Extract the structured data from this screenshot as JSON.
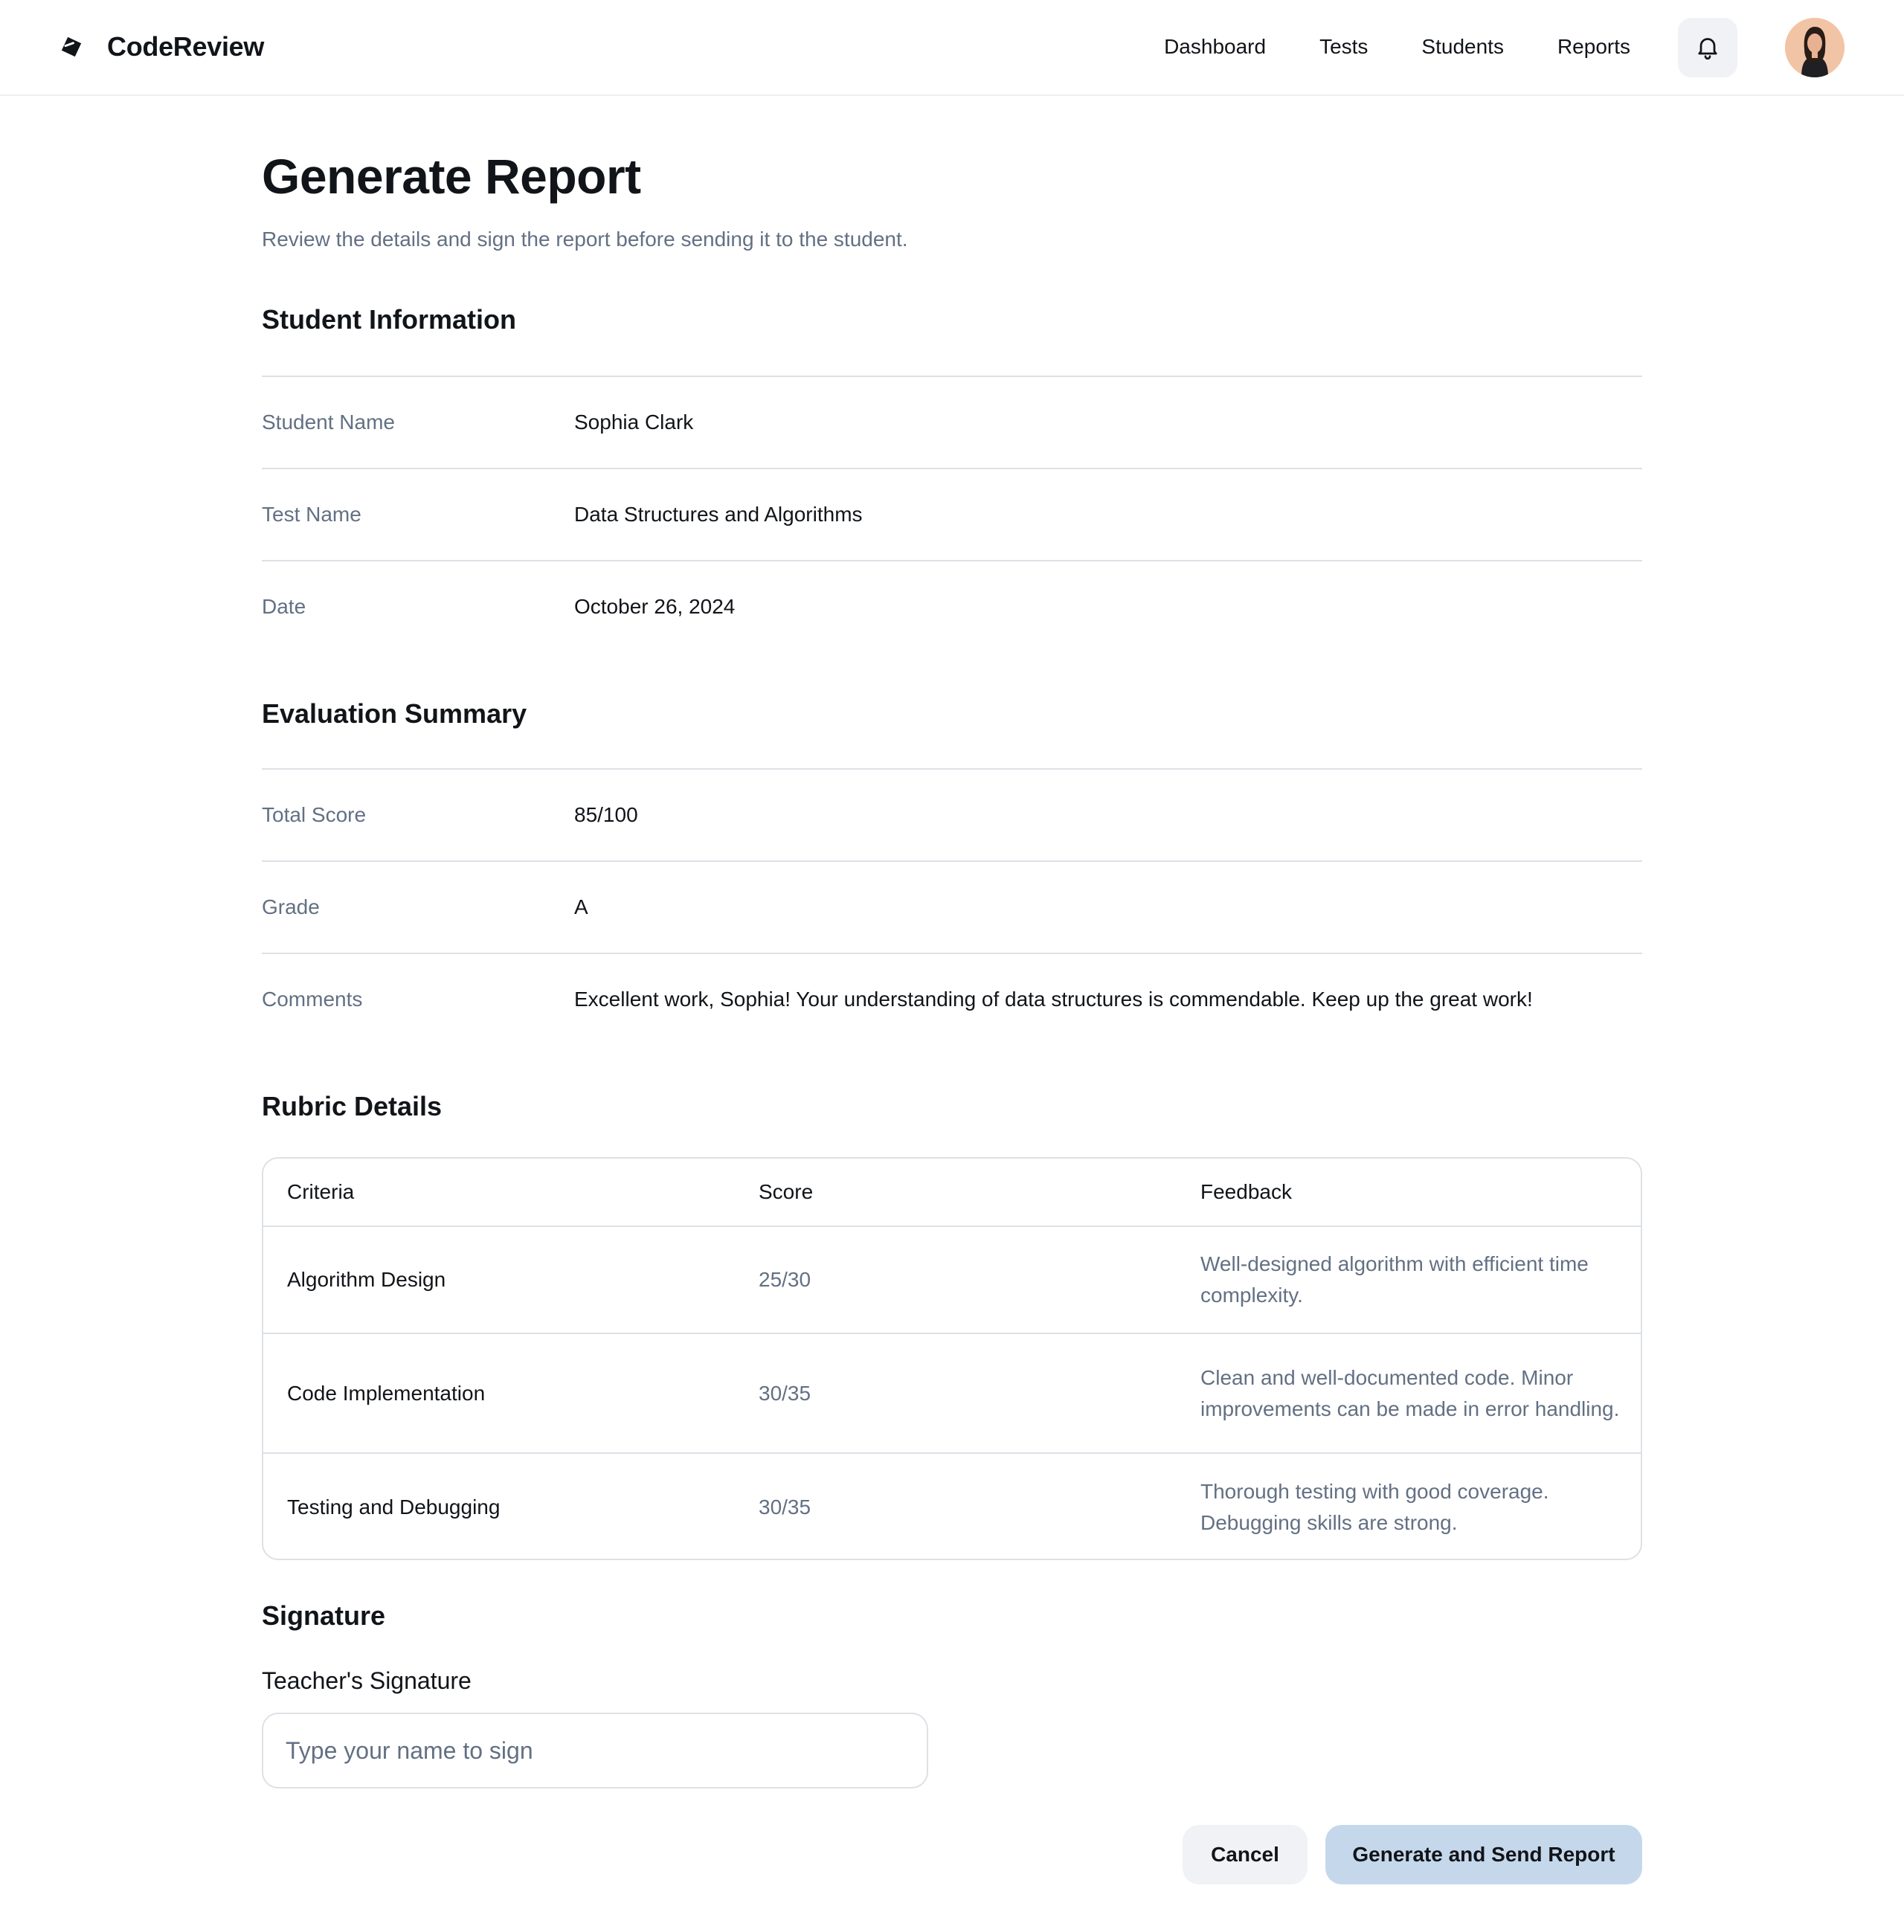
{
  "app": {
    "name": "CodeReview"
  },
  "nav": [
    "Dashboard",
    "Tests",
    "Students",
    "Reports"
  ],
  "page": {
    "title": "Generate Report",
    "subtitle": "Review the details and sign the report before sending it to the student."
  },
  "student_info": {
    "title": "Student Information",
    "rows": [
      {
        "label": "Student Name",
        "value": "Sophia Clark"
      },
      {
        "label": "Test Name",
        "value": "Data Structures and Algorithms"
      },
      {
        "label": "Date",
        "value": "October 26, 2024"
      }
    ]
  },
  "evaluation": {
    "title": "Evaluation Summary",
    "rows": [
      {
        "label": "Total Score",
        "value": "85/100"
      },
      {
        "label": "Grade",
        "value": "A"
      },
      {
        "label": "Comments",
        "value": "Excellent work, Sophia! Your understanding of data structures is commendable. Keep up the great work!"
      }
    ]
  },
  "rubric": {
    "title": "Rubric Details",
    "headers": [
      "Criteria",
      "Score",
      "Feedback"
    ],
    "rows": [
      {
        "criteria": "Algorithm Design",
        "score": "25/30",
        "feedback": "Well-designed algorithm with efficient time complexity."
      },
      {
        "criteria": "Code Implementation",
        "score": "30/35",
        "feedback": "Clean and well-documented code. Minor improvements can be made in error handling."
      },
      {
        "criteria": "Testing and Debugging",
        "score": "30/35",
        "feedback": "Thorough testing with good coverage. Debugging skills are strong."
      }
    ]
  },
  "signature": {
    "title": "Signature",
    "label": "Teacher's Signature",
    "placeholder": "Type your name to sign",
    "value": ""
  },
  "actions": {
    "cancel": "Cancel",
    "submit": "Generate and Send Report"
  },
  "icons": {
    "brand": "brand-logo-icon",
    "notifications": "bell-icon",
    "avatar": "user-avatar"
  },
  "colors": {
    "primary_button": "#c5d8eb",
    "secondary_button": "#f0f2f5",
    "muted_text": "#637083",
    "border": "#dde1e6"
  }
}
